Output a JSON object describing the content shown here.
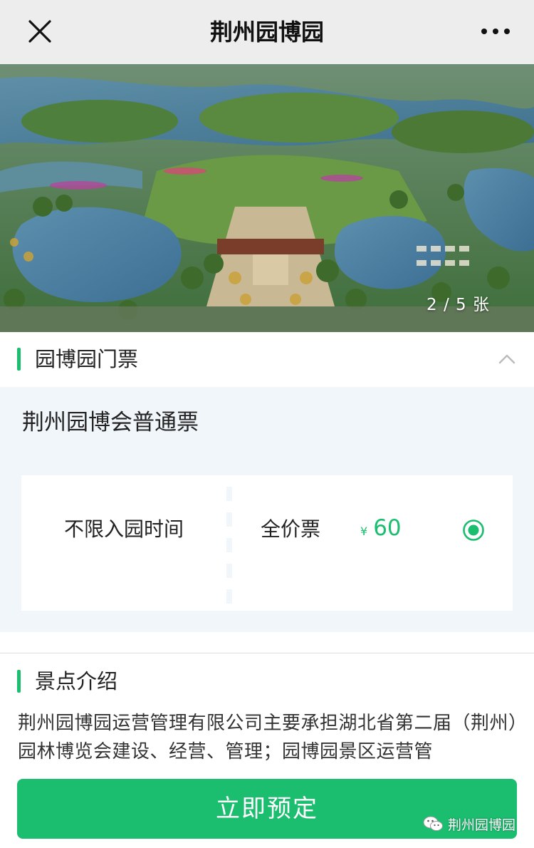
{
  "navbar": {
    "title": "荆州园博园",
    "close_icon": "close-icon",
    "more_icon": "more-dots-icon"
  },
  "hero": {
    "counter": "2 / 5 张"
  },
  "ticket_section": {
    "title": "园博园门票",
    "expand_icon": "chevron-up-icon",
    "ticket_name": "荆州园博会普通票",
    "entry_time": "不限入园时间",
    "ticket_type": "全价票",
    "currency": "¥",
    "price": "60",
    "selected": true
  },
  "intro_section": {
    "title": "景点介绍",
    "text": "荆州园博园运营管理有限公司主要承担湖北省第二届（荆州）园林博览会建设、经营、管理；园博园景区运营管"
  },
  "actions": {
    "book_label": "立即预定"
  },
  "watermark": {
    "text": "荆州园博园"
  },
  "colors": {
    "accent": "#1bbd6f",
    "navbar_bg": "#ededed",
    "ticket_area_bg": "#f1f6fa"
  }
}
